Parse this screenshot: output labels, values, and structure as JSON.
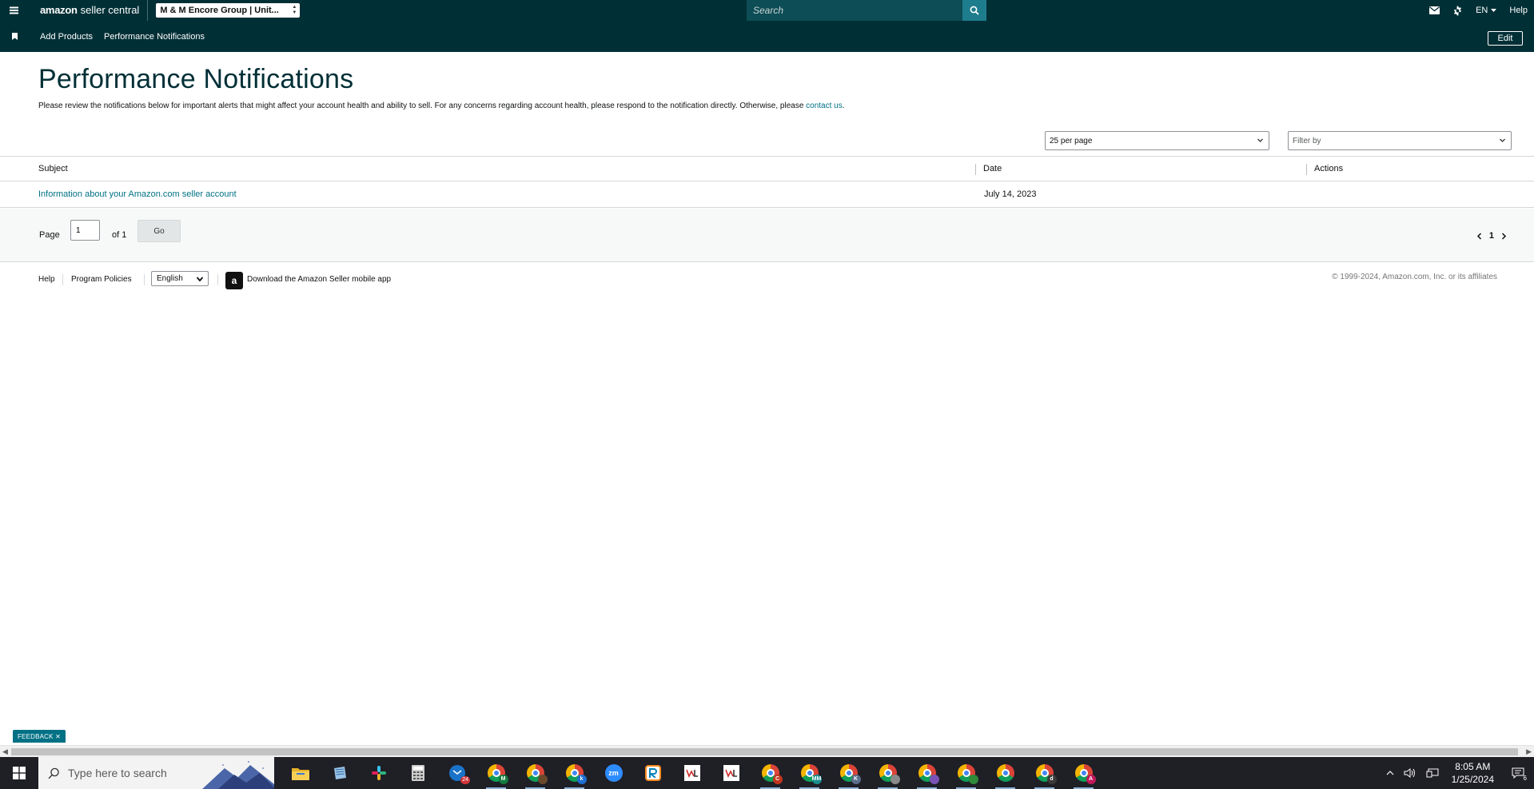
{
  "topnav": {
    "logo_amazon": "amazon",
    "logo_seller_central": "seller central",
    "account": "M & M Encore Group | Unit...",
    "search_placeholder": "Search",
    "language": "EN",
    "help": "Help"
  },
  "subnav": {
    "add_products": "Add Products",
    "performance_notifications": "Performance Notifications",
    "edit": "Edit"
  },
  "page": {
    "title": "Performance Notifications",
    "intro": "Please review the notifications below for important alerts that might affect your account health and ability to sell. For any concerns regarding account health, please respond to the notification directly. Otherwise, please ",
    "contact_link": "contact us",
    "intro_end": "."
  },
  "controls": {
    "per_page": "25 per page",
    "filter_by": "Filter by"
  },
  "table": {
    "headers": {
      "subject": "Subject",
      "date": "Date",
      "actions": "Actions"
    },
    "rows": [
      {
        "subject": "Information about your Amazon.com seller account",
        "date": "July 14, 2023"
      }
    ]
  },
  "pagination": {
    "page_label": "Page",
    "page_value": "1",
    "of_label": "of 1",
    "go": "Go",
    "current": "1"
  },
  "footer": {
    "help": "Help",
    "program_policies": "Program Policies",
    "language": "English",
    "app_badge": "a",
    "download_app": "Download the Amazon Seller mobile app",
    "copyright": "© 1999-2024, Amazon.com, Inc. or its affiliates"
  },
  "feedback": "FEEDBACK ✕",
  "taskbar": {
    "search_placeholder": "Type here to search",
    "time": "8:05 AM",
    "date": "1/25/2024",
    "notification_count": "6",
    "outlook_badge": "24",
    "zoom_label": "zm",
    "badges": [
      "M",
      "",
      "k",
      "",
      "C",
      "MM",
      "K",
      "",
      "",
      "",
      "",
      "d",
      "A"
    ]
  },
  "colors": {
    "nav_bg": "#002f36",
    "link": "#007185",
    "title": "#002f36"
  }
}
